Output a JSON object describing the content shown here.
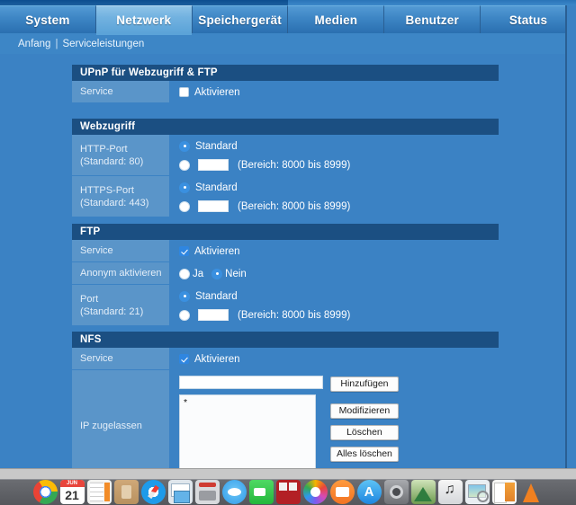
{
  "tabs": [
    {
      "label": "System",
      "active": false
    },
    {
      "label": "Netzwerk",
      "active": true
    },
    {
      "label": "Speichergerät",
      "active": false
    },
    {
      "label": "Medien",
      "active": false
    },
    {
      "label": "Benutzer",
      "active": false
    },
    {
      "label": "Status",
      "active": false
    }
  ],
  "breadcrumb": {
    "home": "Anfang",
    "separator": "|",
    "current": "Serviceleistungen"
  },
  "sections": {
    "upnp": {
      "title": "UPnP für Webzugriff & FTP",
      "service_label": "Service",
      "enable_label": "Aktivieren",
      "enabled": false
    },
    "webzugriff": {
      "title": "Webzugriff",
      "http": {
        "label": "HTTP-Port",
        "sublabel": "(Standard: 80)",
        "standard_label": "Standard",
        "standard_selected": true,
        "custom_value": "",
        "range_hint": "(Bereich: 8000 bis 8999)"
      },
      "https": {
        "label": "HTTPS-Port",
        "sublabel": "(Standard: 443)",
        "standard_label": "Standard",
        "standard_selected": true,
        "custom_value": "",
        "range_hint": "(Bereich: 8000 bis 8999)"
      }
    },
    "ftp": {
      "title": "FTP",
      "service_label": "Service",
      "enable_label": "Aktivieren",
      "enabled": true,
      "anon_label": "Anonym aktivieren",
      "anon_yes": "Ja",
      "anon_no": "Nein",
      "anon_value": "Nein",
      "port": {
        "label": "Port",
        "sublabel": "(Standard: 21)",
        "standard_label": "Standard",
        "standard_selected": true,
        "custom_value": "",
        "range_hint": "(Bereich: 8000 bis 8999)"
      }
    },
    "nfs": {
      "title": "NFS",
      "service_label": "Service",
      "enable_label": "Aktivieren",
      "enabled": true,
      "ip_label": "IP zugelassen",
      "ip_input_value": "",
      "add_button": "Hinzufügen",
      "modify_button": "Modifizieren",
      "delete_button": "Löschen",
      "delete_all_button": "Alles löschen",
      "ip_list": [
        "*"
      ]
    }
  },
  "dock": {
    "items": [
      {
        "name": "chrome-icon",
        "class": "ic-chrome"
      },
      {
        "name": "calendar-icon",
        "class": "ic-cal",
        "month": "JUN",
        "day": "21"
      },
      {
        "name": "numbers-icon",
        "class": "ic-numbers"
      },
      {
        "name": "contacts-icon",
        "class": "ic-contacts"
      },
      {
        "name": "safari-icon",
        "class": "ic-safari"
      },
      {
        "name": "mail-icon",
        "class": "ic-mail"
      },
      {
        "name": "vise-icon",
        "class": "ic-vise"
      },
      {
        "name": "messages-icon",
        "class": "ic-messages"
      },
      {
        "name": "facetime-icon",
        "class": "ic-facetime"
      },
      {
        "name": "photo-booth-icon",
        "class": "ic-photobooth"
      },
      {
        "name": "photos-icon",
        "class": "ic-photos"
      },
      {
        "name": "ibooks-icon",
        "class": "ic-ibooks"
      },
      {
        "name": "app-store-icon",
        "class": "ic-appstore",
        "glyph": "A"
      },
      {
        "name": "system-preferences-icon",
        "class": "ic-sysprefs"
      },
      {
        "name": "aperture-icon",
        "class": "ic-aperture"
      },
      {
        "name": "garageband-icon",
        "class": "ic-garageband"
      },
      {
        "name": "preview-icon",
        "class": "ic-preview"
      },
      {
        "name": "pages-icon",
        "class": "ic-pages"
      },
      {
        "name": "vlc-icon",
        "class": "ic-vlc"
      }
    ]
  },
  "colors": {
    "page_bg": "#3b82c4",
    "section_header": "#1b4f82",
    "row_label_bg": "#5a95c9",
    "tab_active": "#72b2e0",
    "accent": "#2f86e0"
  }
}
